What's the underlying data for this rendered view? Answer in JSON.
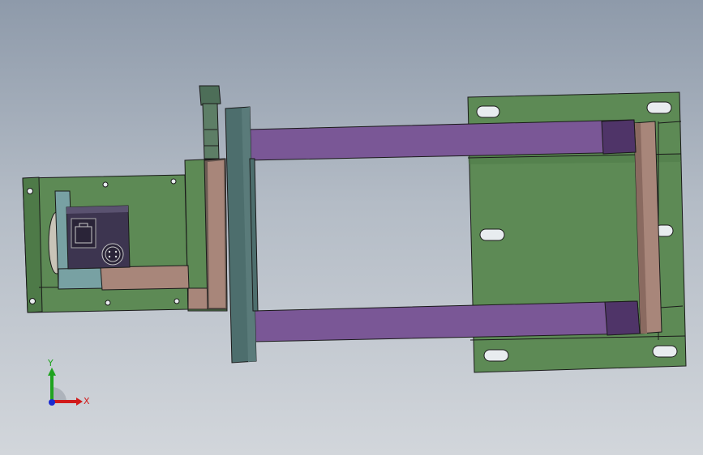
{
  "colors": {
    "plate_green": "#5d8a55",
    "plate_green_dark": "#4e7a48",
    "edge": "#1a1a1a",
    "rail_purple": "#7a5796",
    "rail_purple_dark": "#4f3468",
    "post_slate": "#4d6e6d",
    "tan_bar": "#a8867a",
    "tan_bar_dark": "#8a6a60",
    "teal_bracket": "#78a1a3",
    "camera_body": "#3d3550",
    "hole_fill": "#e8ecef",
    "axis_x": "#d11a1a",
    "axis_y": "#1fa31f",
    "axis_z": "#1a2ad1"
  },
  "icons": {
    "triad": "coordinate-triad-icon",
    "ethernet": "ethernet-port-icon",
    "connector": "round-connector-icon"
  },
  "triad": {
    "x_label": "X",
    "y_label": "Y"
  }
}
